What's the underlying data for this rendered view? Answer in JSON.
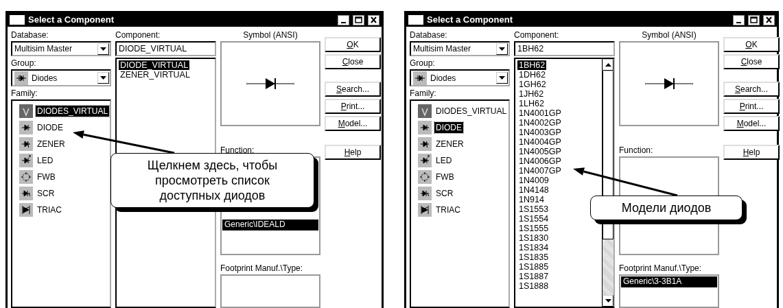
{
  "dialogs": [
    {
      "title": "Select a Component",
      "database": {
        "label": "Database:",
        "value": "Multisim Master"
      },
      "group": {
        "label": "Group:",
        "value": "Diodes"
      },
      "family": {
        "label": "Family:",
        "items": [
          {
            "name": "DIODES_VIRTUAL",
            "selected": true
          },
          {
            "name": "DIODE",
            "selected": false
          },
          {
            "name": "ZENER",
            "selected": false
          },
          {
            "name": "LED",
            "selected": false
          },
          {
            "name": "FWB",
            "selected": false
          },
          {
            "name": "SCR",
            "selected": false
          },
          {
            "name": "TRIAC",
            "selected": false
          }
        ]
      },
      "component": {
        "label": "Component:",
        "value": "DIODE_VIRTUAL",
        "scrollbar": false,
        "items": [
          {
            "name": "DIODE_VIRTUAL",
            "selected": true
          },
          {
            "name": "ZENER_VIRTUAL",
            "selected": false
          }
        ]
      },
      "symbol": {
        "label": "Symbol (ANSI)"
      },
      "function": {
        "label": "Function:",
        "items": [
          {
            "name": "Generic\\IDEALD",
            "selected": true
          }
        ]
      },
      "footprint": {
        "label": "Footprint Manuf.\\Type:"
      },
      "buttons": [
        "OK",
        "Close",
        "Search...",
        "Print...",
        "Model...",
        "Help"
      ],
      "callout": {
        "text": "Щелкнем здесь, чтобы\nпросмотреть список\nдоступных диодов"
      }
    },
    {
      "title": "Select a Component",
      "database": {
        "label": "Database:",
        "value": "Multisim Master"
      },
      "group": {
        "label": "Group:",
        "value": "Diodes"
      },
      "family": {
        "label": "Family:",
        "items": [
          {
            "name": "DIODES_VIRTUAL",
            "selected": false
          },
          {
            "name": "DIODE",
            "selected": true
          },
          {
            "name": "ZENER",
            "selected": false
          },
          {
            "name": "LED",
            "selected": false
          },
          {
            "name": "FWB",
            "selected": false
          },
          {
            "name": "SCR",
            "selected": false
          },
          {
            "name": "TRIAC",
            "selected": false
          }
        ]
      },
      "component": {
        "label": "Component:",
        "value": "1BH62",
        "scrollbar": true,
        "items": [
          {
            "name": "1BH62",
            "selected": true
          },
          {
            "name": "1DH62",
            "selected": false
          },
          {
            "name": "1GH62",
            "selected": false
          },
          {
            "name": "1JH62",
            "selected": false
          },
          {
            "name": "1LH62",
            "selected": false
          },
          {
            "name": "1N4001GP",
            "selected": false
          },
          {
            "name": "1N4002GP",
            "selected": false
          },
          {
            "name": "1N4003GP",
            "selected": false
          },
          {
            "name": "1N4004GP",
            "selected": false
          },
          {
            "name": "1N4005GP",
            "selected": false
          },
          {
            "name": "1N4006GP",
            "selected": false
          },
          {
            "name": "1N4007GP",
            "selected": false
          },
          {
            "name": "1N4009",
            "selected": false
          },
          {
            "name": "1N4148",
            "selected": false
          },
          {
            "name": "1N914",
            "selected": false
          },
          {
            "name": "1S1553",
            "selected": false
          },
          {
            "name": "1S1554",
            "selected": false
          },
          {
            "name": "1S1555",
            "selected": false
          },
          {
            "name": "1S1830",
            "selected": false
          },
          {
            "name": "1S1834",
            "selected": false
          },
          {
            "name": "1S1835",
            "selected": false
          },
          {
            "name": "1S1885",
            "selected": false
          },
          {
            "name": "1S1887",
            "selected": false
          },
          {
            "name": "1S1888",
            "selected": false
          }
        ]
      },
      "symbol": {
        "label": "Symbol (ANSI)"
      },
      "function": {
        "label": "Function:"
      },
      "footprint": {
        "label": "Footprint Manuf.\\Type:",
        "items": [
          {
            "name": "Generic\\3-3B1A",
            "selected": true
          }
        ]
      },
      "buttons": [
        "OK",
        "Close",
        "Search...",
        "Print...",
        "Model...",
        "Help"
      ],
      "callout": {
        "text": "Модели диодов"
      }
    }
  ]
}
